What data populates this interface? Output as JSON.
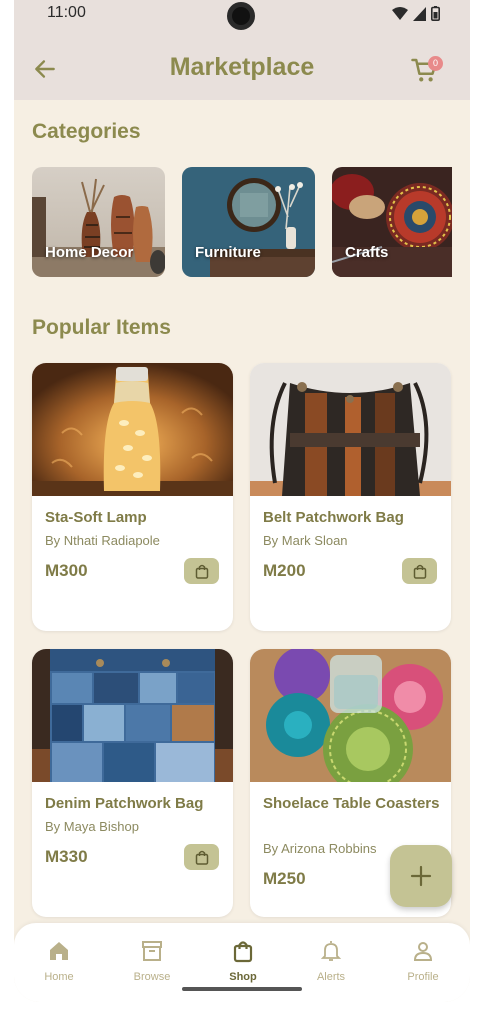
{
  "status": {
    "time": "11:00"
  },
  "header": {
    "title": "Marketplace",
    "cart_count": "0"
  },
  "sections": {
    "categories": "Categories",
    "popular": "Popular Items"
  },
  "categories": [
    {
      "label": "Home Decor"
    },
    {
      "label": "Furniture"
    },
    {
      "label": "Crafts"
    }
  ],
  "items": [
    {
      "name": "Sta-Soft Lamp",
      "by": "By Nthati Radiapole",
      "price": "M300"
    },
    {
      "name": "Belt Patchwork Bag",
      "by": "By Mark Sloan",
      "price": "M200"
    },
    {
      "name": "Denim Patchwork Bag",
      "by": "By Maya Bishop",
      "price": "M330"
    },
    {
      "name": "Shoelace Table Coasters",
      "by": "By Arizona Robbins",
      "price": "M250"
    }
  ],
  "nav": [
    {
      "label": "Home",
      "icon": "home-icon"
    },
    {
      "label": "Browse",
      "icon": "archive-icon"
    },
    {
      "label": "Shop",
      "icon": "shopping-bag-icon"
    },
    {
      "label": "Alerts",
      "icon": "bell-icon"
    },
    {
      "label": "Profile",
      "icon": "person-icon"
    }
  ],
  "colors": {
    "accent": "#8c8a4e",
    "background": "#f6efe3",
    "button": "#c4c394",
    "badge": "#e88a8a"
  }
}
